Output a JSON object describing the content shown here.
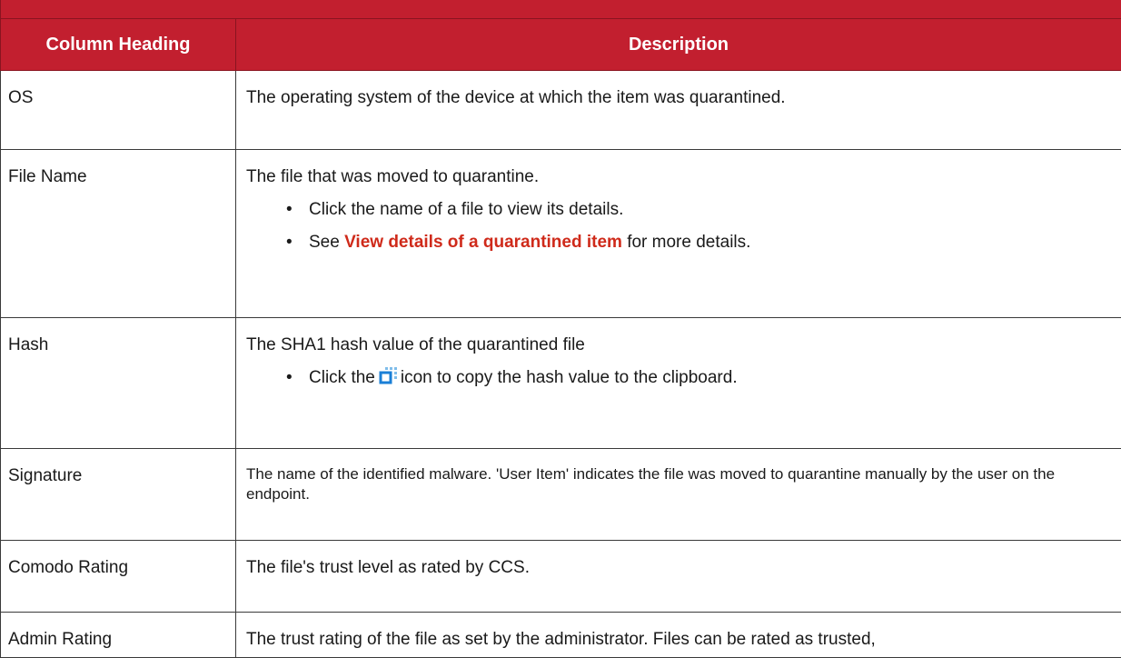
{
  "table": {
    "headers": {
      "column": "Column Heading",
      "description": "Description"
    },
    "rows": [
      {
        "name": "OS",
        "description": "The operating system of the device at which the item was quarantined."
      },
      {
        "name": "File Name",
        "description": "The file that was moved to quarantine.",
        "bullets": [
          "Click the name of a file to view its details.",
          {
            "pre": "See ",
            "link": "View details of a quarantined item",
            "post": " for more details."
          }
        ]
      },
      {
        "name": "Hash",
        "description": "The SHA1 hash value of the quarantined file",
        "bullets": [
          {
            "pre": "Click the",
            "icon": "copy-icon",
            "post": "icon to copy the hash value to the clipboard."
          }
        ]
      },
      {
        "name": "Signature",
        "description": "The name of the identified malware. 'User Item' indicates the file was moved to quarantine manually by the user on the endpoint."
      },
      {
        "name": "Comodo Rating",
        "description": "The file's trust level as rated by CCS."
      },
      {
        "name": "Admin Rating",
        "description": "The trust rating of the file as set by the administrator. Files can be rated as trusted,"
      }
    ]
  },
  "bullet_char": "•",
  "colors": {
    "header_bg": "#c21f2f",
    "header_text": "#ffffff",
    "link": "#cf2a1a",
    "border": "#3a3a3a",
    "icon": "#1a7fd6"
  }
}
